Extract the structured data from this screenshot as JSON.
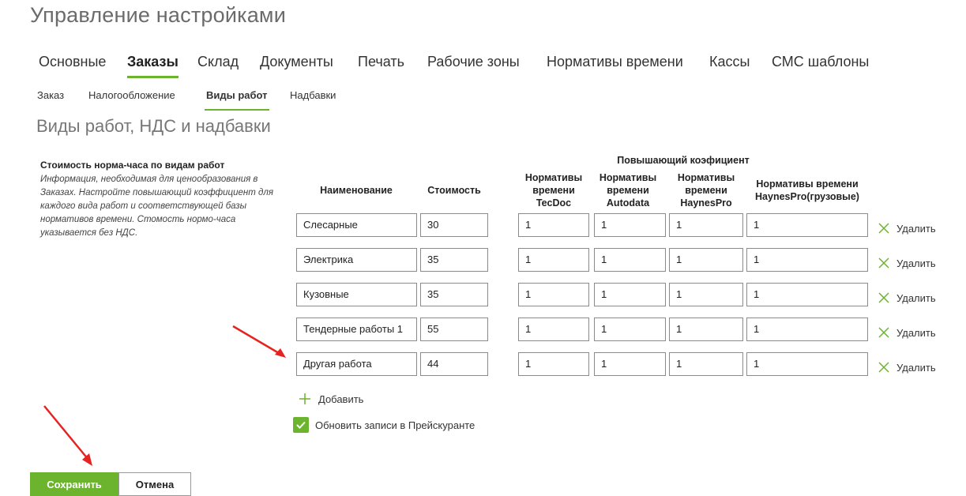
{
  "page_title": "Управление настройками",
  "main_tabs": [
    {
      "label": "Основные",
      "active": false
    },
    {
      "label": "Заказы",
      "active": true
    },
    {
      "label": "Склад",
      "active": false
    },
    {
      "label": "Документы",
      "active": false
    },
    {
      "label": "Печать",
      "active": false
    },
    {
      "label": "Рабочие зоны",
      "active": false
    },
    {
      "label": "Нормативы времени",
      "active": false
    },
    {
      "label": "Кассы",
      "active": false
    },
    {
      "label": "СМС шаблоны",
      "active": false
    }
  ],
  "sub_tabs": [
    {
      "label": "Заказ",
      "active": false
    },
    {
      "label": "Налогообложение",
      "active": false
    },
    {
      "label": "Виды работ",
      "active": true
    },
    {
      "label": "Надбавки",
      "active": false
    }
  ],
  "section_title": "Виды работ, НДС и надбавки",
  "info": {
    "heading": "Стоимость норма-часа по видам работ",
    "text": "Информация, необходимая для ценообразования в Заказах. Настройте повышающий коэффициент для каждого вида работ и соответствующей базы нормативов времени. Стомость нормо-часа указывается без НДС."
  },
  "table": {
    "group_header": "Повышающий коэфициент",
    "headers": {
      "name": "Наименование",
      "cost": "Стоимость",
      "tecdoc": "Нормативы времени TecDoc",
      "autodata": "Нормативы времени Autodata",
      "haynespro": "Нормативы времени HaynesPro",
      "haynespro_truck": "Нормативы времени HaynesPro(грузовые)"
    },
    "rows": [
      {
        "name": "Слесарные",
        "cost": "30",
        "tecdoc": "1",
        "autodata": "1",
        "haynespro": "1",
        "haynespro_truck": "1"
      },
      {
        "name": "Электрика",
        "cost": "35",
        "tecdoc": "1",
        "autodata": "1",
        "haynespro": "1",
        "haynespro_truck": "1"
      },
      {
        "name": "Кузовные",
        "cost": "35",
        "tecdoc": "1",
        "autodata": "1",
        "haynespro": "1",
        "haynespro_truck": "1"
      },
      {
        "name": "Тендерные работы 1",
        "cost": "55",
        "tecdoc": "1",
        "autodata": "1",
        "haynespro": "1",
        "haynespro_truck": "1"
      },
      {
        "name": "Другая работа",
        "cost": "44",
        "tecdoc": "1",
        "autodata": "1",
        "haynespro": "1",
        "haynespro_truck": "1"
      }
    ],
    "delete_label": "Удалить"
  },
  "add_label": "Добавить",
  "update_checkbox": {
    "label": "Обновить записи в Прейскуранте",
    "checked": true
  },
  "buttons": {
    "save": "Сохранить",
    "cancel": "Отмена"
  },
  "colors": {
    "accent": "#6cb32e",
    "annotation_arrow": "#e52421"
  }
}
